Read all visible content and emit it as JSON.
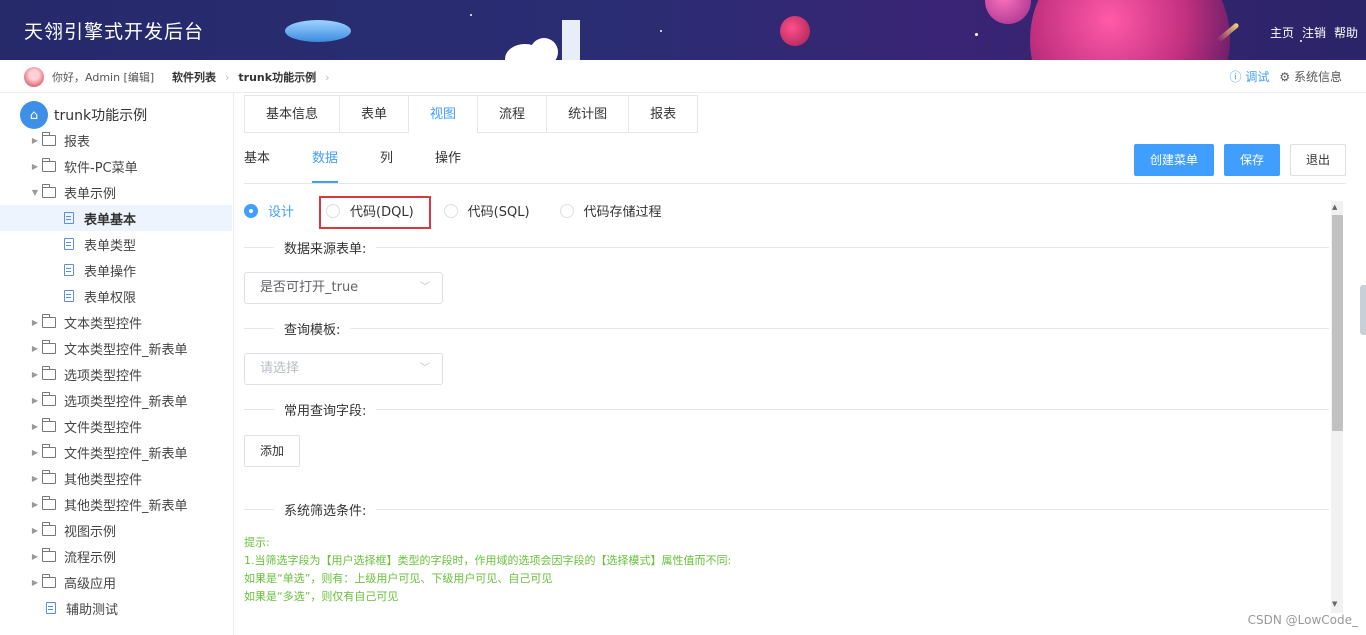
{
  "header": {
    "title": "天翎引擎式开发后台",
    "nav": [
      "主页",
      "注销",
      "帮助"
    ]
  },
  "breadcrumb": {
    "greeting": "你好，Admin [编辑]",
    "items": [
      "软件列表",
      "trunk功能示例"
    ],
    "debug": "调试",
    "system_info": "系统信息"
  },
  "sidebar": {
    "root": "trunk功能示例",
    "items": [
      {
        "label": "报表",
        "type": "folder"
      },
      {
        "label": "软件-PC菜单",
        "type": "folder"
      },
      {
        "label": "表单示例",
        "type": "folder",
        "expanded": true
      },
      {
        "label": "表单基本",
        "type": "doc",
        "selected": true
      },
      {
        "label": "表单类型",
        "type": "doc"
      },
      {
        "label": "表单操作",
        "type": "doc"
      },
      {
        "label": "表单权限",
        "type": "doc"
      },
      {
        "label": "文本类型控件",
        "type": "folder"
      },
      {
        "label": "文本类型控件_新表单",
        "type": "folder"
      },
      {
        "label": "选项类型控件",
        "type": "folder"
      },
      {
        "label": "选项类型控件_新表单",
        "type": "folder"
      },
      {
        "label": "文件类型控件",
        "type": "folder"
      },
      {
        "label": "文件类型控件_新表单",
        "type": "folder"
      },
      {
        "label": "其他类型控件",
        "type": "folder"
      },
      {
        "label": "其他类型控件_新表单",
        "type": "folder"
      },
      {
        "label": "视图示例",
        "type": "folder"
      },
      {
        "label": "流程示例",
        "type": "folder"
      },
      {
        "label": "高级应用",
        "type": "folder"
      },
      {
        "label": "辅助测试",
        "type": "doc-root"
      }
    ]
  },
  "main": {
    "tabs": [
      "基本信息",
      "表单",
      "视图",
      "流程",
      "统计图",
      "报表"
    ],
    "active_tab": 2,
    "subtabs": [
      "基本",
      "数据",
      "列",
      "操作"
    ],
    "active_subtab": 1,
    "buttons": {
      "create_menu": "创建菜单",
      "save": "保存",
      "exit": "退出"
    },
    "radios": [
      "设计",
      "代码(DQL)",
      "代码(SQL)",
      "代码存储过程"
    ],
    "radio_selected": 0,
    "sections": {
      "data_source": "数据来源表单:",
      "query_template": "查询模板:",
      "common_fields": "常用查询字段:",
      "system_filter": "系统筛选条件:"
    },
    "data_source_value": "是否可打开_true",
    "query_template_placeholder": "请选择",
    "add_button": "添加",
    "tips": [
      "提示:",
      "1.当筛选字段为【用户选择框】类型的字段时，作用域的选项会因字段的【选择模式】属性值而不同:",
      "如果是“单选”，则有：上级用户可见、下级用户可见、自己可见",
      "如果是“多选”，则仅有自己可见"
    ]
  },
  "watermark": "CSDN @LowCode_",
  "colors": {
    "primary": "#409eff",
    "tip_green": "#67c23a",
    "highlight_red": "#d9383f"
  }
}
